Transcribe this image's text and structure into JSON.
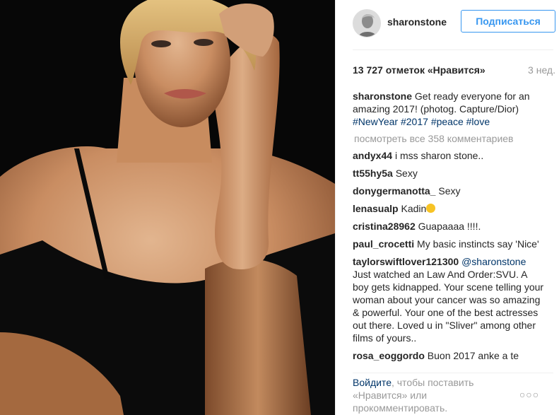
{
  "header": {
    "username": "sharonstone",
    "follow_label": "Подписаться"
  },
  "meta": {
    "likes": "13 727 отметок «Нравится»",
    "time": "3 нед."
  },
  "caption": {
    "user": "sharonstone",
    "text": "Get ready everyone for an amazing 2017! (photog. Capture/Dior)",
    "hashtags": [
      "#NewYear",
      "#2017",
      "#peace",
      "#love"
    ]
  },
  "view_all": "посмотреть все 358 комментариев",
  "comments": [
    {
      "user": "andyx44",
      "text": "i mss sharon stone.."
    },
    {
      "user": "tt55hy5a",
      "text": "Sexy"
    },
    {
      "user": "donygermanotta_",
      "text": "Sexy"
    },
    {
      "user": "lenasualp",
      "text": "Kadin",
      "emoji": "smile-emoji"
    },
    {
      "user": "cristina28962",
      "text": "Guapaaaa !!!!."
    },
    {
      "user": "paul_crocetti",
      "text": "My basic instincts say 'Nice'"
    },
    {
      "user": "taylorswiftlover121300",
      "mention": "@sharonstone",
      "text": "Just watched an Law And Order:SVU. A boy gets kidnapped. Your scene telling your woman about your cancer was so amazing & powerful. Your one of the best actresses out there. Loved u in \"Sliver\" among other films of yours.."
    },
    {
      "user": "rosa_eoggordo",
      "text": "Buon 2017 anke a te"
    }
  ],
  "footer": {
    "login_label": "Войдите",
    "rest": ", чтобы поставить «Нравится» или прокомментировать.",
    "more_label": "○○○"
  },
  "colors": {
    "link": "#003569",
    "accent": "#3897f0",
    "muted": "#999999",
    "text": "#262626"
  },
  "icons": {
    "more": "ellipsis-icon",
    "avatar": "profile-avatar"
  }
}
